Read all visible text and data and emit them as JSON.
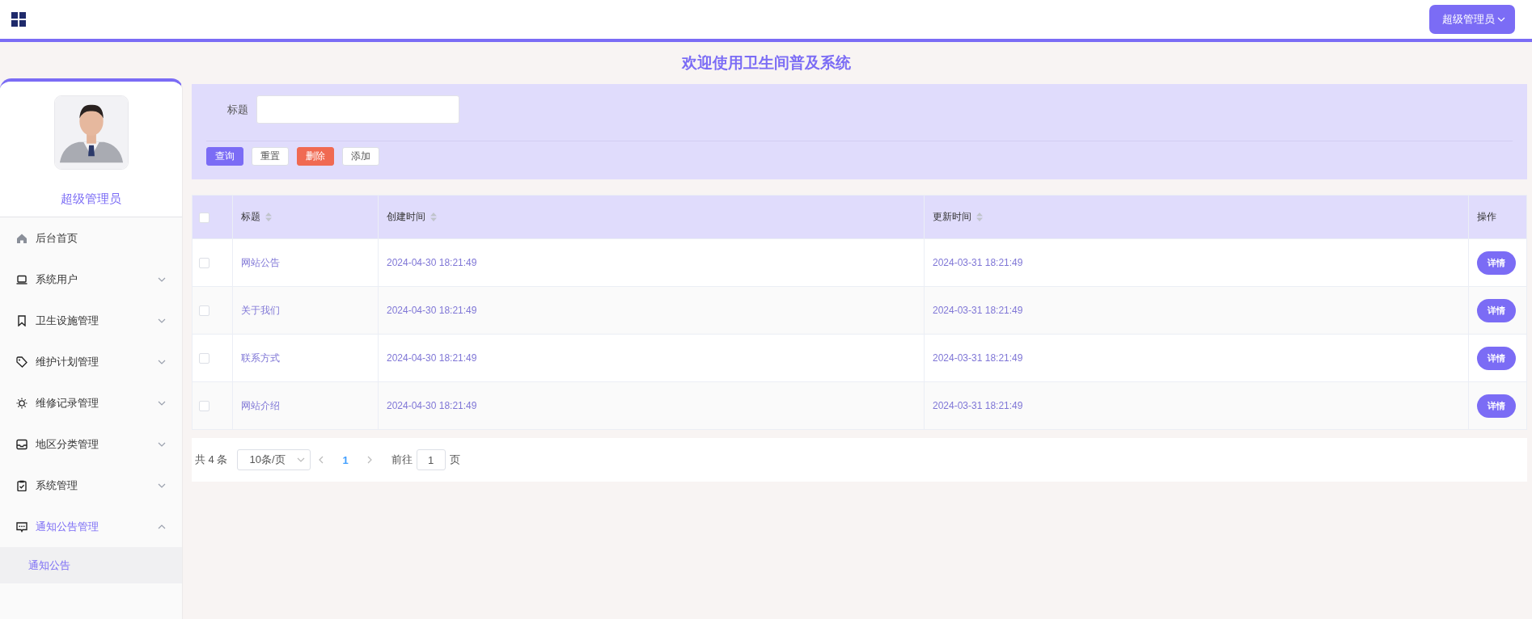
{
  "header": {
    "user_menu": "超级管理员"
  },
  "title": "欢迎使用卫生间普及系统",
  "sidebar": {
    "profile": {
      "name": "超级管理员"
    },
    "items": [
      {
        "label": "后台首页",
        "kind": "link"
      },
      {
        "label": "系统用户",
        "kind": "group",
        "expanded": false
      },
      {
        "label": "卫生设施管理",
        "kind": "group",
        "expanded": false
      },
      {
        "label": "维护计划管理",
        "kind": "group",
        "expanded": false
      },
      {
        "label": "维修记录管理",
        "kind": "group",
        "expanded": false
      },
      {
        "label": "地区分类管理",
        "kind": "group",
        "expanded": false
      },
      {
        "label": "系统管理",
        "kind": "group",
        "expanded": false
      },
      {
        "label": "通知公告管理",
        "kind": "group",
        "expanded": true,
        "children": [
          {
            "label": "通知公告",
            "selected": true
          }
        ]
      }
    ]
  },
  "search": {
    "fields": [
      {
        "label": "标题"
      }
    ],
    "buttons": [
      {
        "label": "查询",
        "kind": "primary"
      },
      {
        "label": "重置",
        "kind": "plain"
      },
      {
        "label": "删除",
        "kind": "danger"
      },
      {
        "label": "添加",
        "kind": "plain"
      }
    ]
  },
  "table": {
    "select_all": {
      "checked": false
    },
    "columns": [
      {
        "label": "标题",
        "sortable": true
      },
      {
        "label": "创建时间",
        "sortable": true
      },
      {
        "label": "更新时间",
        "sortable": true
      },
      {
        "label": "操作",
        "sortable": false
      }
    ],
    "rows": [
      {
        "checked": false,
        "title": "网站公告",
        "created": "2024-04-30 18:21:49",
        "updated": "2024-03-31 18:21:49",
        "action": "详情"
      },
      {
        "checked": false,
        "title": "关于我们",
        "created": "2024-04-30 18:21:49",
        "updated": "2024-03-31 18:21:49",
        "action": "详情"
      },
      {
        "checked": false,
        "title": "联系方式",
        "created": "2024-04-30 18:21:49",
        "updated": "2024-03-31 18:21:49",
        "action": "详情"
      },
      {
        "checked": false,
        "title": "网站介绍",
        "created": "2024-04-30 18:21:49",
        "updated": "2024-03-31 18:21:49",
        "action": "详情"
      }
    ]
  },
  "pagination": {
    "total": "共 4 条",
    "page_size": "10条/页",
    "pages": [
      {
        "label": "1",
        "selected": true
      }
    ],
    "goto_label": "前往",
    "goto_value": "1",
    "goto_suffix": "页"
  }
}
